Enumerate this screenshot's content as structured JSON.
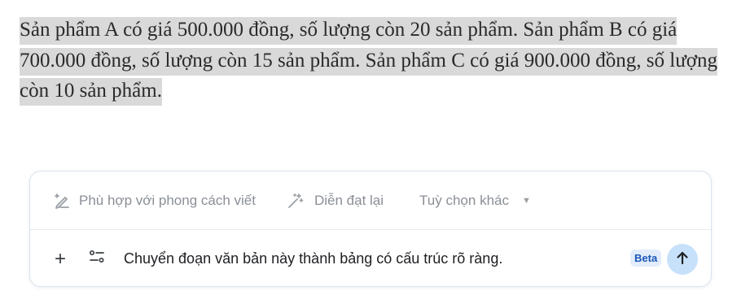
{
  "document": {
    "selected_text": "Sản phẩm A có giá 500.000 đồng, số lượng còn 20 sản phẩm. Sản phẩm B có giá 700.000 đồng, số lượng còn 15 sản phẩm. Sản phẩm C có giá 900.000 đồng, số lượng còn 10 sản phẩm."
  },
  "assistant": {
    "suggestions": [
      {
        "label": "Phù hợp với phong cách viết",
        "icon": "pencil-sparkle-icon"
      },
      {
        "label": "Diễn đạt lại",
        "icon": "magic-wand-icon"
      },
      {
        "label": "Tuỳ chọn khác",
        "icon": "chevron-down-icon"
      }
    ],
    "prompt": "Chuyển đoạn văn bản này thành bảng có cấu trúc rõ ràng.",
    "beta_label": "Beta",
    "add_icon": "+",
    "colors": {
      "accent": "#1a56b6",
      "send_bg": "#c8e1fb",
      "highlight": "#d9d9d9"
    }
  }
}
